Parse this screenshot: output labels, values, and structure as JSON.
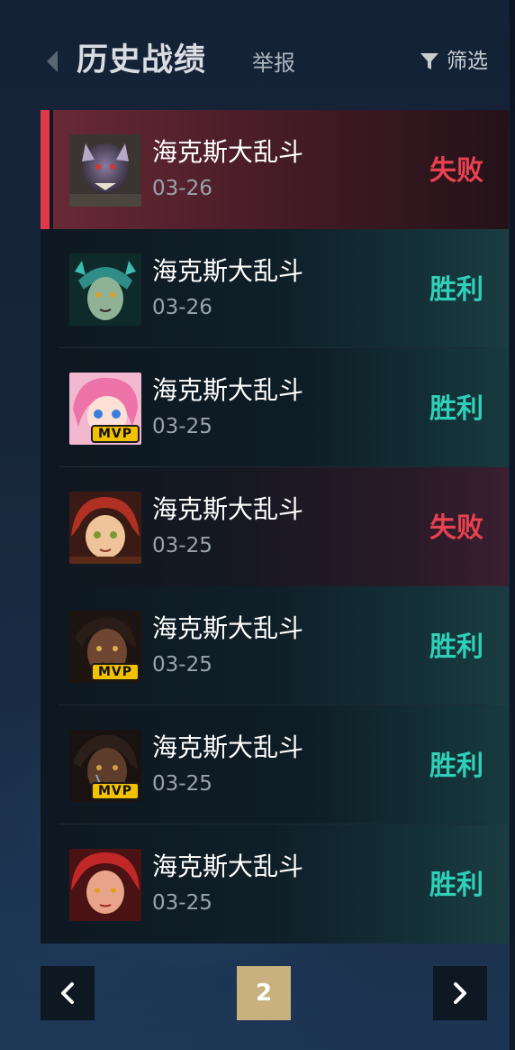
{
  "header": {
    "title": "历史战绩",
    "report_label": "举报",
    "filter_label": "筛选"
  },
  "matches": [
    {
      "mode": "海克斯大乱斗",
      "date": "03-26",
      "result": "失败",
      "outcome": "loss",
      "mvp": false,
      "selected": true,
      "avatar": "champion-portrait-icon"
    },
    {
      "mode": "海克斯大乱斗",
      "date": "03-26",
      "result": "胜利",
      "outcome": "win",
      "mvp": false,
      "selected": false,
      "avatar": "champion-portrait-icon"
    },
    {
      "mode": "海克斯大乱斗",
      "date": "03-25",
      "result": "胜利",
      "outcome": "win",
      "mvp": true,
      "selected": false,
      "avatar": "champion-portrait-icon"
    },
    {
      "mode": "海克斯大乱斗",
      "date": "03-25",
      "result": "失败",
      "outcome": "loss",
      "mvp": false,
      "selected": false,
      "avatar": "champion-portrait-icon"
    },
    {
      "mode": "海克斯大乱斗",
      "date": "03-25",
      "result": "胜利",
      "outcome": "win",
      "mvp": true,
      "selected": false,
      "avatar": "champion-portrait-icon"
    },
    {
      "mode": "海克斯大乱斗",
      "date": "03-25",
      "result": "胜利",
      "outcome": "win",
      "mvp": true,
      "selected": false,
      "avatar": "champion-portrait-icon"
    },
    {
      "mode": "海克斯大乱斗",
      "date": "03-25",
      "result": "胜利",
      "outcome": "win",
      "mvp": false,
      "selected": false,
      "avatar": "champion-portrait-icon"
    }
  ],
  "mvp_label": "MVP",
  "pagination": {
    "current_page": "2",
    "prev_icon": "chevron-left-icon",
    "next_icon": "chevron-right-icon"
  },
  "colors": {
    "loss": "#e8414f",
    "win": "#2fd0b8",
    "selected_bar": "#e2394a",
    "page_current_bg": "#c8b17e"
  }
}
